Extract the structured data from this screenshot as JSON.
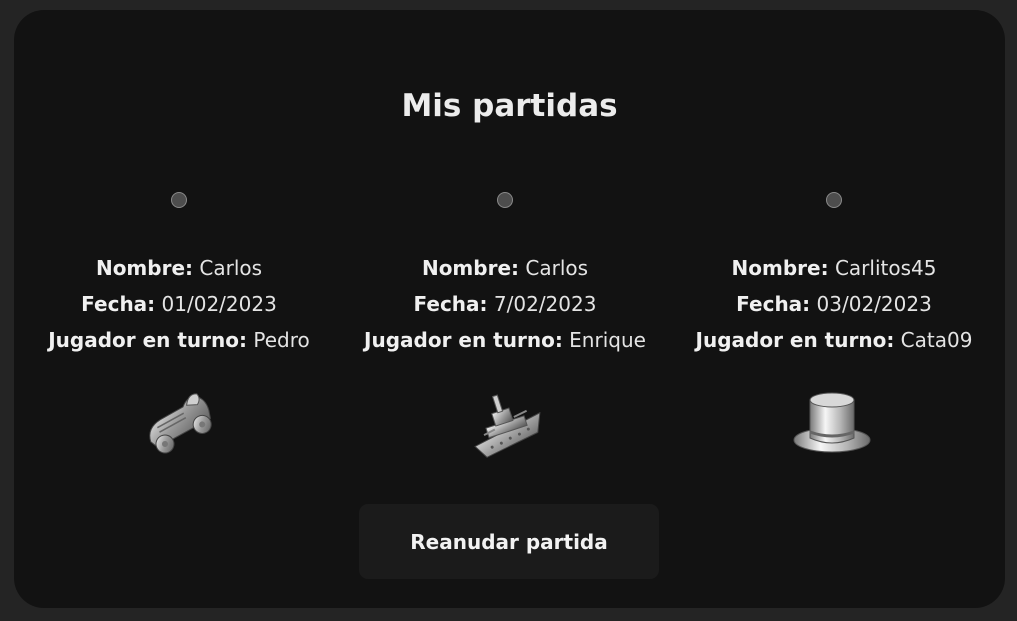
{
  "title": "Mis partidas",
  "labels": {
    "name": "Nombre:",
    "date": "Fecha:",
    "turn": "Jugador en turno:"
  },
  "games": [
    {
      "name": "Carlos",
      "date": "01/02/2023",
      "turn": "Pedro",
      "token_icon": "car-token-icon"
    },
    {
      "name": "Carlos",
      "date": "7/02/2023",
      "turn": "Enrique",
      "token_icon": "battleship-token-icon"
    },
    {
      "name": "Carlitos45",
      "date": "03/02/2023",
      "turn": "Cata09",
      "token_icon": "top-hat-token-icon"
    }
  ],
  "resume_button": "Reanudar partida",
  "colors": {
    "background": "#242424",
    "panel": "#121212",
    "button": "#1b1b1b",
    "text": "#e8e8e8"
  }
}
